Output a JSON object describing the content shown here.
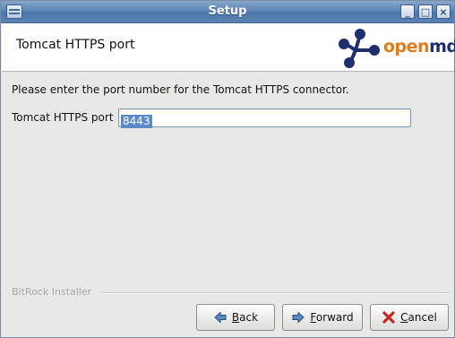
{
  "window": {
    "title": "Setup"
  },
  "header": {
    "title": "Tomcat HTTPS port",
    "logo": {
      "part1": "open",
      "part2": "mdx",
      "icon": "network-nodes-logo"
    }
  },
  "main": {
    "instruction": "Please enter the port number for the Tomcat HTTPS connector.",
    "field": {
      "label": "Tomcat HTTPS port",
      "value": "8443"
    }
  },
  "footer": {
    "brand": "BitRock Installer",
    "buttons": {
      "back": {
        "mnemonic": "B",
        "rest": "ack",
        "icon": "arrow-left-icon"
      },
      "forward": {
        "mnemonic": "F",
        "rest": "orward",
        "icon": "arrow-right-icon"
      },
      "cancel": {
        "mnemonic": "C",
        "rest": "ancel",
        "icon": "red-x-icon"
      }
    }
  },
  "colors": {
    "titlebar": "#5f86b6",
    "logo_orange": "#e07b1a",
    "logo_navy": "#1f2f6e",
    "selection": "#5c8ac5"
  }
}
